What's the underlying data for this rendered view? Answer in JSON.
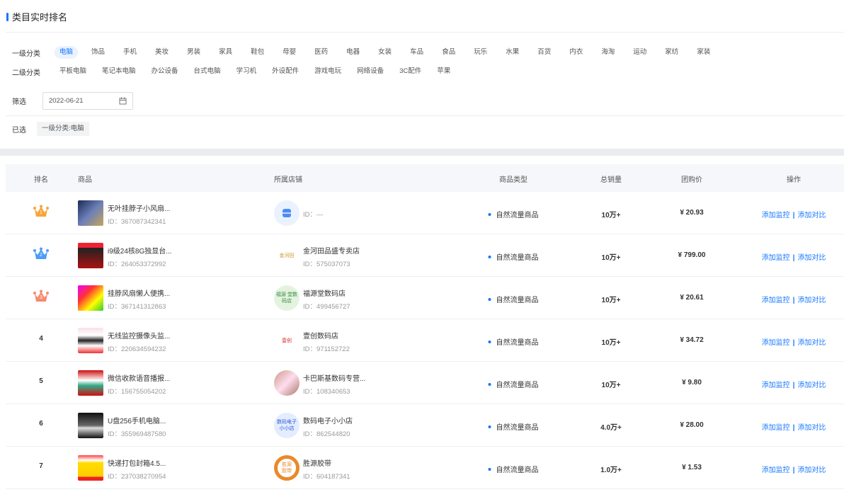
{
  "title": "类目实时排名",
  "filters": {
    "level1_label": "一级分类",
    "level1": [
      "电脑",
      "饰品",
      "手机",
      "美妆",
      "男装",
      "家具",
      "鞋包",
      "母婴",
      "医药",
      "电器",
      "女装",
      "车品",
      "食品",
      "玩乐",
      "水果",
      "百货",
      "内衣",
      "海淘",
      "运动",
      "家纺",
      "家装"
    ],
    "level1_active": "电脑",
    "level2_label": "二级分类",
    "level2": [
      "平板电脑",
      "笔记本电脑",
      "办公设备",
      "台式电脑",
      "学习机",
      "外设配件",
      "游戏电玩",
      "网络设备",
      "3C配件",
      "苹果"
    ],
    "filter_label": "筛选",
    "date": "2022-06-21",
    "selected_label": "已选",
    "selected_tag": "一级分类:电脑"
  },
  "table": {
    "headers": [
      "排名",
      "商品",
      "所属店铺",
      "商品类型",
      "总销量",
      "团购价",
      "操作"
    ],
    "rows": [
      {
        "rank": "1",
        "name": "无叶挂脖子小风扇...",
        "pid": "ID：367087342341",
        "shop": "",
        "sid": "ID：—",
        "logo": "",
        "type": "自然流量商品",
        "sales": "10万+",
        "price": "¥ 20.93"
      },
      {
        "rank": "2",
        "name": "i9级24核8G独显台...",
        "pid": "ID：264053372992",
        "shop": "金河田品盛专卖店",
        "sid": "ID：575037073",
        "logo": "金河田",
        "type": "自然流量商品",
        "sales": "10万+",
        "price": "¥ 799.00"
      },
      {
        "rank": "3",
        "name": "挂脖风扇懒人便携...",
        "pid": "ID：367141312863",
        "shop": "福源堂数码店",
        "sid": "ID：499456727",
        "logo": "福源 堂数码店",
        "type": "自然流量商品",
        "sales": "10万+",
        "price": "¥ 20.61"
      },
      {
        "rank": "4",
        "name": "无线监控摄像头监...",
        "pid": "ID：220634594232",
        "shop": "壹创数码店",
        "sid": "ID：971152722",
        "logo": "壹创",
        "type": "自然流量商品",
        "sales": "10万+",
        "price": "¥ 34.72"
      },
      {
        "rank": "5",
        "name": "微信收款语音播报...",
        "pid": "ID：156755054202",
        "shop": "卡巴斯基数码专营...",
        "sid": "ID：108340653",
        "logo": "",
        "type": "自然流量商品",
        "sales": "10万+",
        "price": "¥ 9.80"
      },
      {
        "rank": "6",
        "name": "U盘256手机电脑...",
        "pid": "ID：355969487580",
        "shop": "数码电子小小店",
        "sid": "ID：862544820",
        "logo": "数码电子 小小店",
        "type": "自然流量商品",
        "sales": "4.0万+",
        "price": "¥ 28.00"
      },
      {
        "rank": "7",
        "name": "快递打包封箱4.5...",
        "pid": "ID：237038270954",
        "shop": "胜源胶带",
        "sid": "ID：604187341",
        "logo": "胜源 胶带",
        "type": "自然流量商品",
        "sales": "1.0万+",
        "price": "¥ 1.53"
      }
    ],
    "op_monitor": "添加监控",
    "op_separator": "|",
    "op_compare": "添加对比"
  },
  "colors": {
    "accent": "#1677ff",
    "gold": "#f7a53b",
    "silver": "#4a9df7",
    "bronze": "#f58b6d"
  }
}
